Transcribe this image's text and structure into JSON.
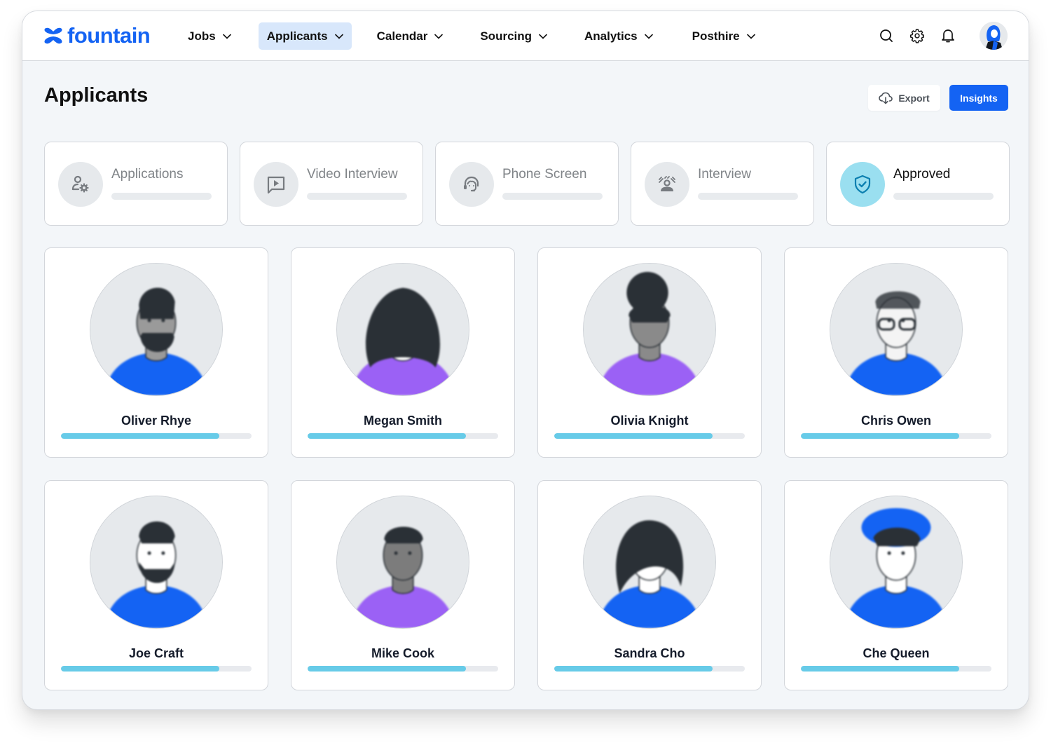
{
  "brand": {
    "name": "fountain",
    "color": "#1463f3"
  },
  "nav": {
    "items": [
      {
        "label": "Jobs",
        "active": false
      },
      {
        "label": "Applicants",
        "active": true
      },
      {
        "label": "Calendar",
        "active": false
      },
      {
        "label": "Sourcing",
        "active": false
      },
      {
        "label": "Analytics",
        "active": false
      },
      {
        "label": "Posthire",
        "active": false
      }
    ],
    "icons": [
      "search-icon",
      "gear-icon",
      "bell-icon"
    ]
  },
  "page": {
    "title": "Applicants",
    "actions": {
      "export_label": "Export",
      "insights_label": "Insights"
    }
  },
  "stages": [
    {
      "label": "Applications",
      "icon": "user-gear-icon",
      "active": false
    },
    {
      "label": "Video Interview",
      "icon": "video-message-icon",
      "active": false
    },
    {
      "label": "Phone Screen",
      "icon": "headset-icon",
      "active": false
    },
    {
      "label": "Interview",
      "icon": "presenter-icon",
      "active": false
    },
    {
      "label": "Approved",
      "icon": "shield-check-icon",
      "active": true
    }
  ],
  "applicants": [
    {
      "name": "Oliver Rhye",
      "progress": 0.83,
      "shirt_color": "#1463f3",
      "hair": "short-beard"
    },
    {
      "name": "Megan Smith",
      "progress": 0.83,
      "shirt_color": "#9b61f5",
      "hair": "long-curly"
    },
    {
      "name": "Olivia Knight",
      "progress": 0.83,
      "shirt_color": "#9b61f5",
      "hair": "afro-puff"
    },
    {
      "name": "Chris Owen",
      "progress": 0.83,
      "shirt_color": "#1463f3",
      "hair": "glasses"
    },
    {
      "name": "Joe Craft",
      "progress": 0.83,
      "shirt_color": "#1463f3",
      "hair": "beard"
    },
    {
      "name": "Mike Cook",
      "progress": 0.83,
      "shirt_color": "#9b61f5",
      "hair": "short"
    },
    {
      "name": "Sandra Cho",
      "progress": 0.83,
      "shirt_color": "#1463f3",
      "hair": "bob"
    },
    {
      "name": "Che Queen",
      "progress": 0.83,
      "shirt_color": "#1463f3",
      "hair": "hat"
    }
  ],
  "colors": {
    "accent": "#1463f3",
    "progress": "#67cbe8",
    "approved_icon_bg": "#9adff0",
    "approved_icon": "#0b7fb0"
  }
}
